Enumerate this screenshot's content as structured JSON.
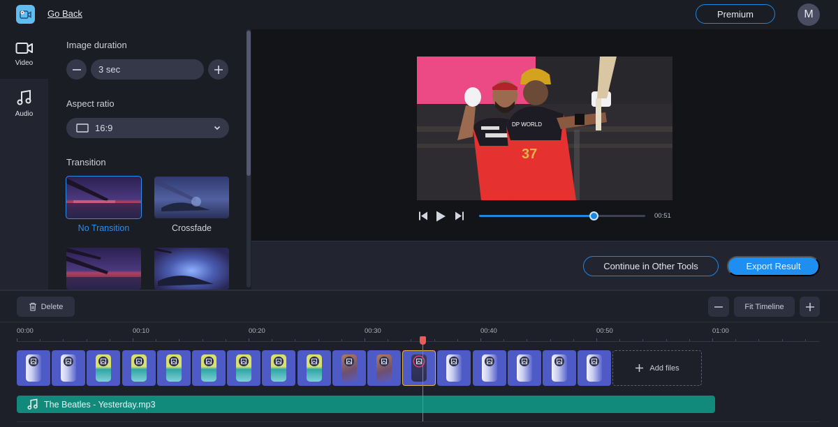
{
  "header": {
    "logo_icon": "video-editor-logo-icon",
    "go_back": "Go Back",
    "premium": "Premium",
    "avatar_initial": "M"
  },
  "sidenav": {
    "items": [
      {
        "label": "Video",
        "icon": "video-camera-icon",
        "active": true
      },
      {
        "label": "Audio",
        "icon": "music-note-icon",
        "active": false
      }
    ]
  },
  "settings": {
    "image_duration": {
      "label": "Image duration",
      "value": "3 sec",
      "decrement_icon": "minus-icon",
      "increment_icon": "plus-icon"
    },
    "aspect_ratio": {
      "label": "Aspect ratio",
      "value": "16:9",
      "icon": "rectangle-icon"
    },
    "transition": {
      "label": "Transition",
      "options": [
        {
          "label": "No Transition",
          "selected": true
        },
        {
          "label": "Crossfade",
          "selected": false
        },
        {
          "label": "",
          "selected": false
        },
        {
          "label": "",
          "selected": false
        }
      ]
    }
  },
  "player": {
    "current_time": "00:51",
    "progress": 0.69
  },
  "actions": {
    "continue": "Continue in Other Tools",
    "export": "Export Result"
  },
  "timeline": {
    "delete": "Delete",
    "fit": "Fit Timeline",
    "ticks": [
      "00:00",
      "00:10",
      "00:20",
      "00:30",
      "00:40",
      "00:50",
      "01:00"
    ],
    "clips": [
      {
        "style": "white"
      },
      {
        "style": "white"
      },
      {
        "style": "teal"
      },
      {
        "style": "teal"
      },
      {
        "style": "teal"
      },
      {
        "style": "teal"
      },
      {
        "style": "teal"
      },
      {
        "style": "teal"
      },
      {
        "style": "teal"
      },
      {
        "style": "brown"
      },
      {
        "style": "brown"
      },
      {
        "style": "dark",
        "selected": true
      },
      {
        "style": "white"
      },
      {
        "style": "white"
      },
      {
        "style": "white"
      },
      {
        "style": "white"
      },
      {
        "style": "white"
      }
    ],
    "add_files": "Add files",
    "audio_track": "The Beatles - Yesterday.mp3",
    "playhead_time_sec": 35
  }
}
